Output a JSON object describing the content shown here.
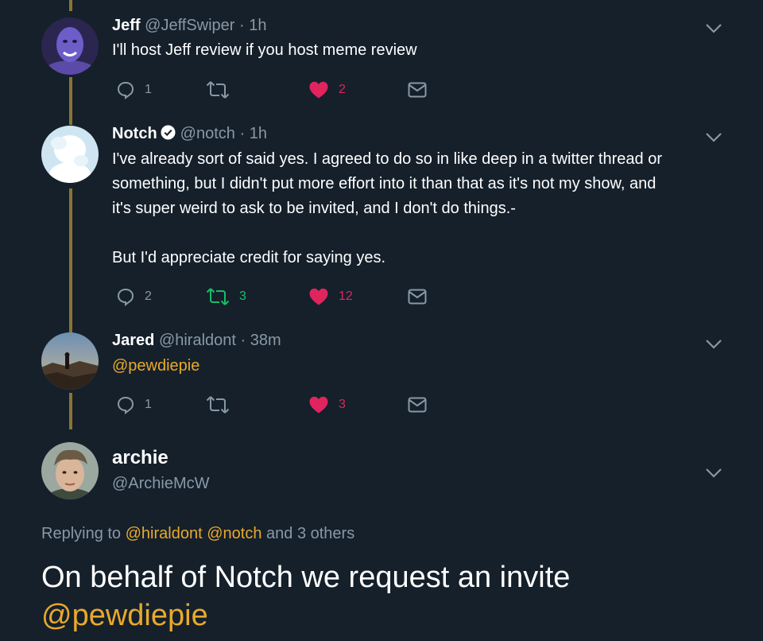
{
  "tweets": [
    {
      "name": "Jeff",
      "handle": "@JeffSwiper",
      "time": "1h",
      "text": "I'll host Jeff review if you host meme review",
      "reply_count": "1",
      "retweet_count": "",
      "like_count": "2",
      "liked": true
    },
    {
      "name": "Notch",
      "handle": "@notch",
      "time": "1h",
      "verified": true,
      "lines": [
        "I've already sort of said yes. I agreed to do so in like deep in a twitter thread or",
        "something, but I didn't put more effort into it than that as it's not my show, and",
        "it's super weird to ask to be invited, and I don't do things.-",
        "",
        "But I'd appreciate credit for saying yes."
      ],
      "reply_count": "2",
      "retweet_count": "3",
      "like_count": "12",
      "liked": true,
      "retweeted": true
    },
    {
      "name": "Jared",
      "handle": "@hiraldont",
      "time": "38m",
      "text": "@pewdiepie",
      "reply_count": "1",
      "retweet_count": "",
      "like_count": "3",
      "liked": true
    }
  ],
  "focused": {
    "name": "archie",
    "handle": "@ArchieMcW",
    "replying_prefix": "Replying to",
    "replying_users": [
      "@hiraldont",
      "@notch"
    ],
    "replying_suffix": "and 3 others",
    "text_line1": "On behalf of Notch we request an invite",
    "text_mention": "@pewdiepie"
  },
  "separators": {
    "dot": "·"
  },
  "colors": {
    "background": "#15202b",
    "thread_line": "#8a7432",
    "mention": "#e9a92b",
    "muted": "#8899a6",
    "like": "#e0245e",
    "retweet": "#17bf63"
  },
  "icons": [
    "reply-icon",
    "retweet-icon",
    "like-icon",
    "dm-icon",
    "chevron-down-icon",
    "verified-badge-icon"
  ]
}
